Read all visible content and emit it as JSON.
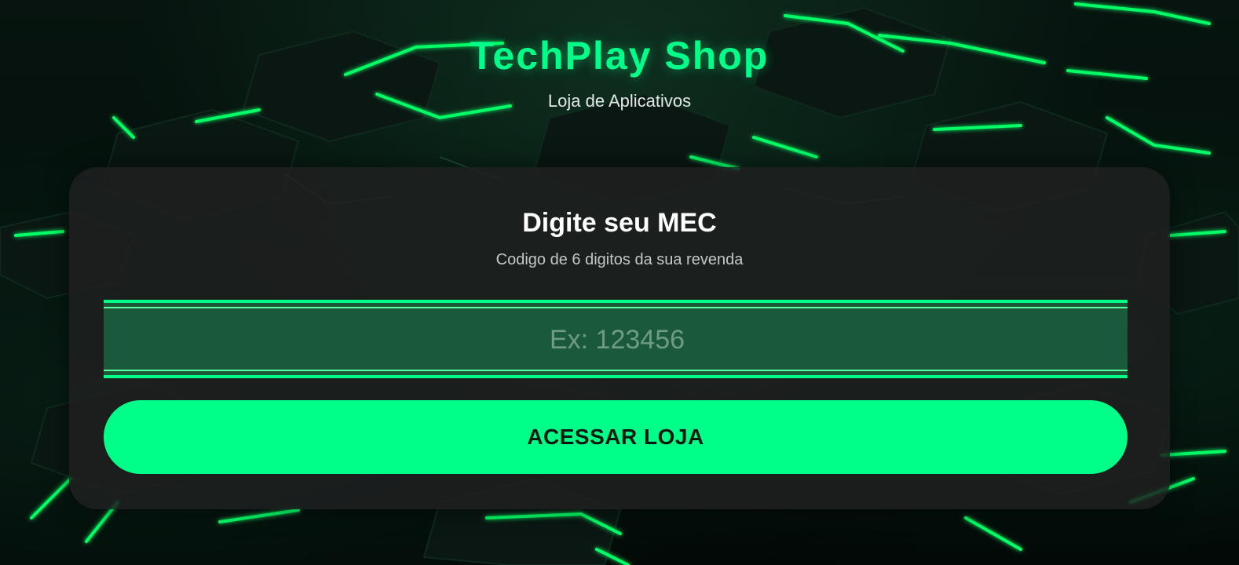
{
  "header": {
    "title": "TechPlay Shop",
    "subtitle": "Loja de Aplicativos"
  },
  "login_card": {
    "title": "Digite seu MEC",
    "subtitle": "Codigo de 6 digitos da sua revenda",
    "mec_input": {
      "value": "",
      "placeholder": "Ex: 123456"
    },
    "submit_label": "ACESSAR LOJA"
  },
  "colors": {
    "accent": "#00ff88",
    "card_background": "#1e201f",
    "input_background": "#1a5a3a",
    "page_background": "#030806"
  }
}
